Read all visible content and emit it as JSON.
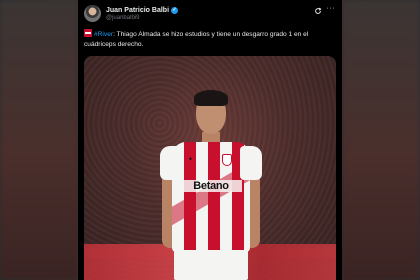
{
  "tweet": {
    "author": {
      "display_name": "Juan Patricio Balbi",
      "handle": "@juanbalbi9",
      "verified": true
    },
    "icons": {
      "refresh": "refresh-icon",
      "more": "more-options-icon",
      "flag": "river-flag-emoji-icon"
    },
    "body": {
      "hashtag": "#River",
      "text": ": Thiago Almada se hizo estudios y tiene un desgarro grado 1 en el cuádriceps derecho."
    },
    "media": {
      "sponsor_text": "Betano"
    }
  },
  "colors": {
    "background": "#000000",
    "text": "#e7e9ea",
    "muted": "#71767b",
    "link": "#1d9bf0",
    "verified": "#1d9bf0",
    "jersey_red": "#c8102e"
  }
}
